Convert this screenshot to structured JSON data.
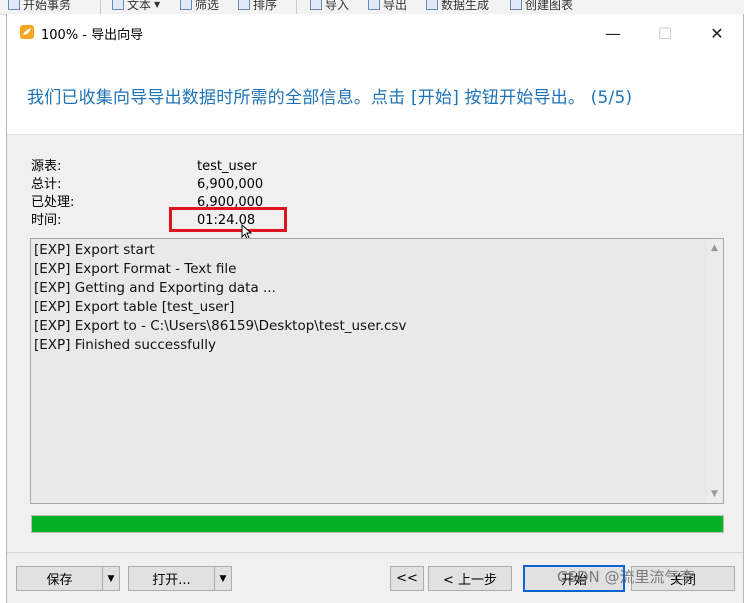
{
  "background_toolbar": {
    "items": [
      "开始事务",
      "文本",
      "筛选",
      "排序",
      "导入",
      "导出",
      "数据生成",
      "创建图表"
    ]
  },
  "window": {
    "title": "100% - 导出向导",
    "minimize_glyph": "—",
    "maximize_glyph": "☐",
    "close_glyph": "✕"
  },
  "header": {
    "text": "我们已收集向导导出数据时所需的全部信息。点击 [开始] 按钮开始导出。 (5/5)"
  },
  "info": {
    "source_label": "源表:",
    "source_value": "test_user",
    "total_label": "总计:",
    "total_value": "6,900,000",
    "processed_label": "已处理:",
    "processed_value": "6,900,000",
    "time_label": "时间:",
    "time_value": "01:24.08"
  },
  "log": {
    "lines": [
      "[EXP] Export start",
      "[EXP] Export Format - Text file",
      "[EXP] Getting and Exporting data ...",
      "[EXP] Export table [test_user]",
      "[EXP] Export to - C:\\Users\\86159\\Desktop\\test_user.csv",
      "[EXP] Finished successfully"
    ]
  },
  "progress": {
    "fraction": 1.0,
    "color": "#06b025"
  },
  "buttons": {
    "save": "保存",
    "open": "打开...",
    "first": "<<",
    "prev": "< 上一步",
    "start": "开始",
    "close": "关闭"
  },
  "watermark": "CSDN @流里流气李",
  "colors": {
    "accent": "#1f73b7",
    "highlight_box": "#e0141e"
  }
}
